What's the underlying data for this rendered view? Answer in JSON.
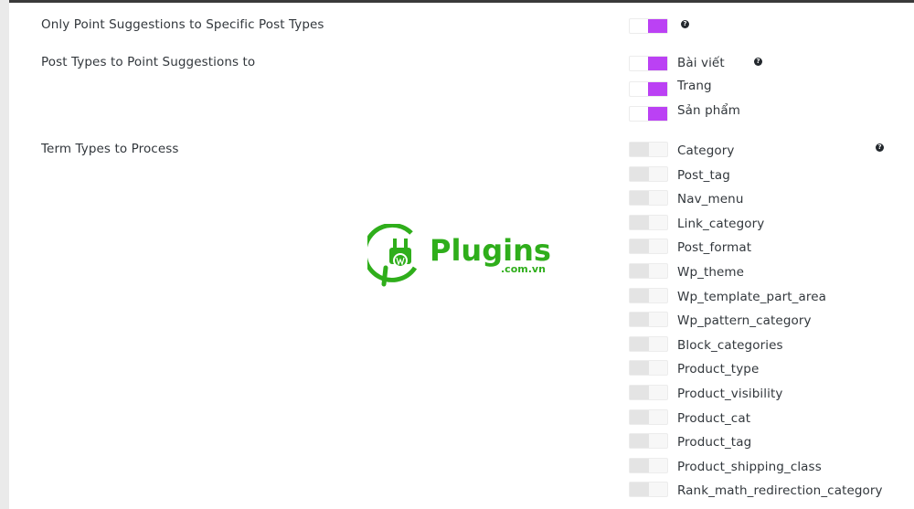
{
  "settings": {
    "only_point": {
      "label": "Only Point Suggestions to Specific Post Types",
      "enabled": true
    },
    "post_types": {
      "label": "Post Types to Point Suggestions to",
      "options": [
        {
          "label": "Bài viết",
          "enabled": true
        },
        {
          "label": "Trang",
          "enabled": true
        },
        {
          "label": "Sản phẩm",
          "enabled": true
        }
      ]
    },
    "term_types": {
      "label": "Term Types to Process",
      "options": [
        {
          "label": "Category",
          "enabled": false
        },
        {
          "label": "Post_tag",
          "enabled": false
        },
        {
          "label": "Nav_menu",
          "enabled": false
        },
        {
          "label": "Link_category",
          "enabled": false
        },
        {
          "label": "Post_format",
          "enabled": false
        },
        {
          "label": "Wp_theme",
          "enabled": false
        },
        {
          "label": "Wp_template_part_area",
          "enabled": false
        },
        {
          "label": "Wp_pattern_category",
          "enabled": false
        },
        {
          "label": "Block_categories",
          "enabled": false
        },
        {
          "label": "Product_type",
          "enabled": false
        },
        {
          "label": "Product_visibility",
          "enabled": false
        },
        {
          "label": "Product_cat",
          "enabled": false
        },
        {
          "label": "Product_tag",
          "enabled": false
        },
        {
          "label": "Product_shipping_class",
          "enabled": false
        },
        {
          "label": "Rank_math_redirection_category",
          "enabled": false
        }
      ]
    }
  },
  "help_icon": {
    "glyph": "?"
  },
  "watermark": {
    "text": "Plugins",
    "sub": ".com.vn"
  },
  "colors": {
    "accent": "#bb41f4",
    "logo_green": "#2fae1b"
  }
}
